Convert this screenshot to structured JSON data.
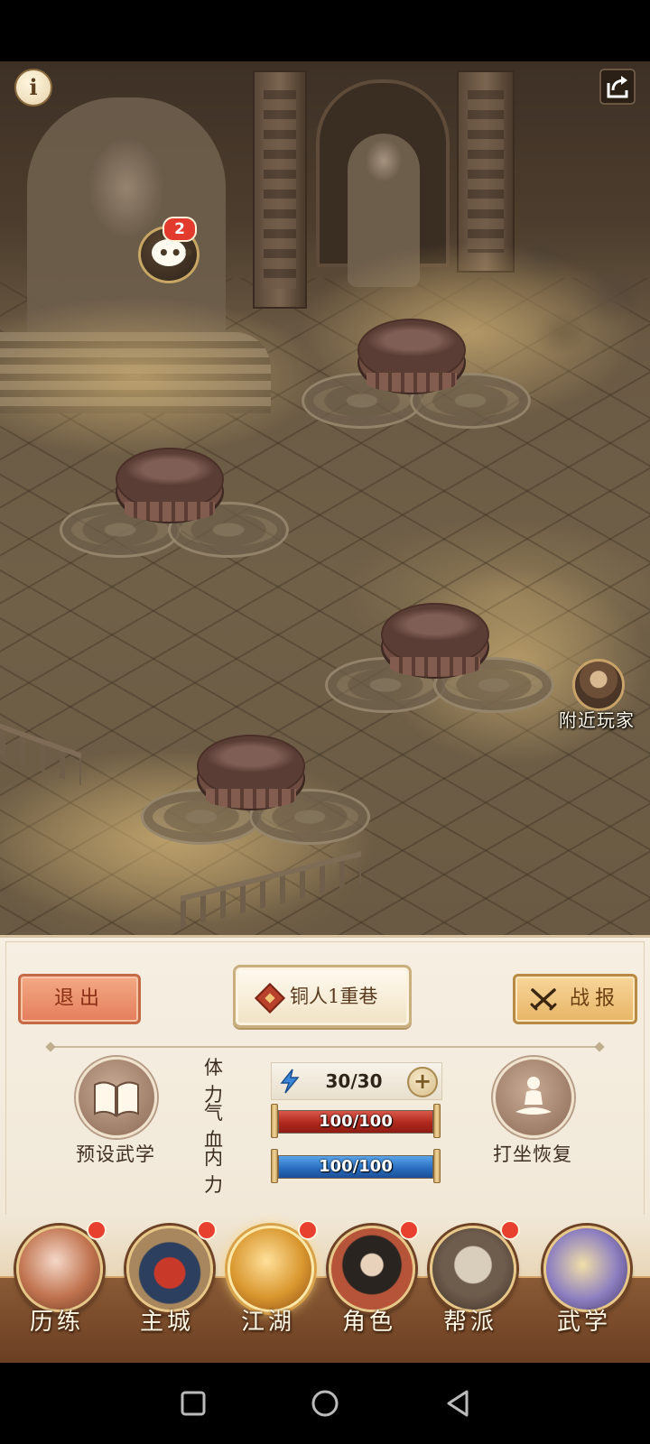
{
  "scene": {
    "chat_badge": "2",
    "nearby_label": "附近玩家"
  },
  "panel": {
    "exit_label": "退出",
    "stage_label": "铜人1重巷",
    "report_label": "战报",
    "preset_label": "预设武学",
    "meditate_label": "打坐恢复",
    "stats": {
      "stamina_label": "体力",
      "stamina_value": "30/30",
      "hp_label": "气血",
      "hp_value": "100/100",
      "hp_fraction": 1.0,
      "mp_label": "内力",
      "mp_value": "100/100",
      "mp_fraction": 1.0
    }
  },
  "nav": {
    "items": [
      {
        "label": "历练",
        "icon": "training-icon",
        "badge": true,
        "active": false
      },
      {
        "label": "主城",
        "icon": "city-gate-icon",
        "badge": true,
        "active": false
      },
      {
        "label": "江湖",
        "icon": "jianghu-sword-icon",
        "badge": true,
        "active": true
      },
      {
        "label": "角色",
        "icon": "character-icon",
        "badge": true,
        "active": false
      },
      {
        "label": "帮派",
        "icon": "guild-emblem-icon",
        "badge": true,
        "active": false
      },
      {
        "label": "武学",
        "icon": "scroll-icon",
        "badge": false,
        "active": false
      }
    ]
  },
  "colors": {
    "exit_button": "#e47e5c",
    "report_button": "#e7b566",
    "hp_bar": "#b0281d",
    "mp_bar": "#2a6fc2",
    "badge": "#e23b2e",
    "panel_bg": "#f6efe2"
  }
}
